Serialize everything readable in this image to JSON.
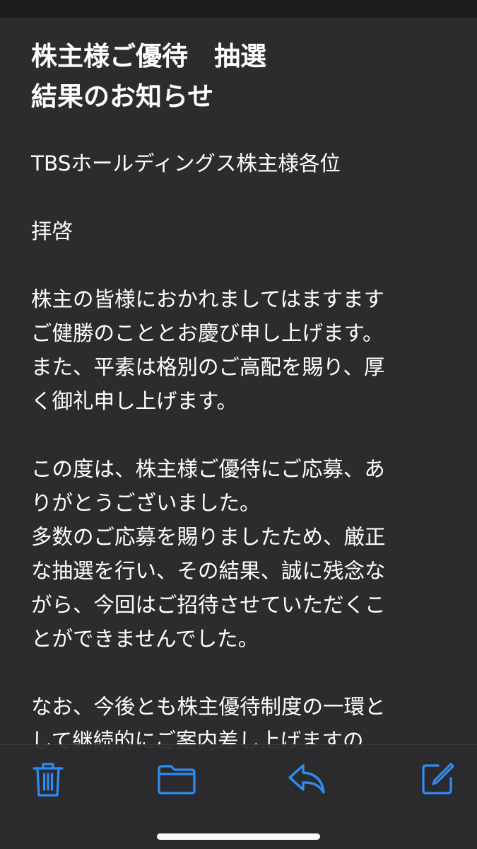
{
  "email": {
    "subject_lines": [
      "株主様ご優待　抽選",
      "結果のお知らせ"
    ],
    "recipient_line": "TBSホールディングス株主様各位",
    "greeting": "拝啓",
    "paragraph1_lines": [
      "株主の皆様におかれましてはますます",
      "ご健勝のこととお慶び申し上げます。",
      "また、平素は格別のご高配を賜り、厚",
      "く御礼申し上げます。"
    ],
    "paragraph2_lines": [
      "この度は、株主様ご優待にご応募、あ",
      "りがとうございました。",
      "多数のご応募を賜りましたため、厳正",
      "な抽選を行い、その結果、誠に残念な",
      "がら、今回はご招待させていただくこ",
      "とができませんでした。"
    ],
    "paragraph3_lines": [
      "なお、今後とも株主優待制度の一環と",
      "して継続的にご案内差し上げますの"
    ]
  },
  "toolbar": {
    "icons": [
      "trash-icon",
      "folder-icon",
      "reply-icon",
      "compose-icon"
    ]
  },
  "colors": {
    "background": "#1c1c1e",
    "card": "#2c2c2e",
    "accent": "#2f8cf5",
    "text": "#ffffff"
  }
}
